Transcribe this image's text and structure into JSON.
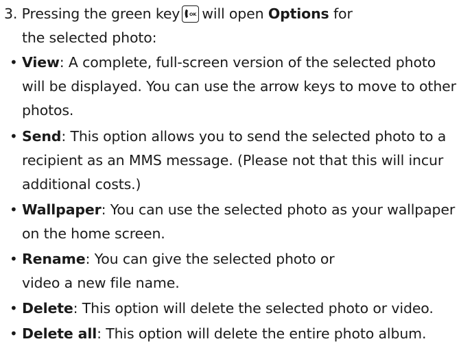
{
  "step": {
    "number": "3.",
    "pre": "Pressing the green key",
    "mid": "will open",
    "bold": "Options",
    "post": "for",
    "line2": "the selected photo:"
  },
  "icons": {
    "green_key": "ok-call-key-icon",
    "ok_text": "OK"
  },
  "bullet_char": "•",
  "items": [
    {
      "term": "View",
      "lines": [
        ": A complete, full-screen version of the selected photo",
        "will be displayed. You can use the arrow keys to move to other",
        "photos."
      ]
    },
    {
      "term": "Send",
      "lines": [
        ": This option allows you to send the selected photo to a",
        "recipient as an MMS message. (Please not that this will incur",
        "additional costs.)"
      ]
    },
    {
      "term": "Wallpaper",
      "lines": [
        ": You can use the selected photo as your wallpaper",
        "on the home screen."
      ]
    },
    {
      "term": "Rename",
      "lines": [
        ": You can give the selected photo or",
        "video a new file name."
      ]
    },
    {
      "term": "Delete",
      "lines": [
        ": This option will delete the selected photo or video."
      ]
    },
    {
      "term": "Delete all",
      "lines": [
        ": This option will delete the entire photo album."
      ]
    }
  ]
}
